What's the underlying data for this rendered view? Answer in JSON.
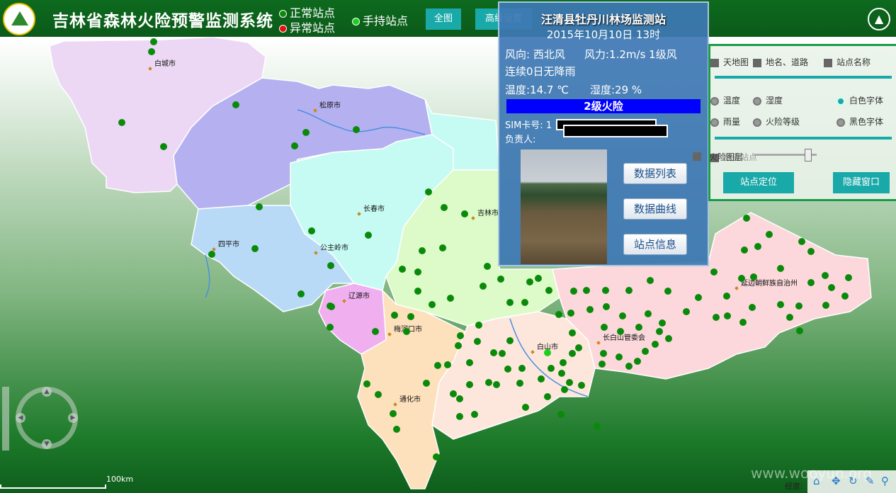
{
  "header": {
    "title": "吉林省森林火险预警监测系统",
    "legend_normal": "正常站点",
    "legend_abnormal": "异常站点",
    "legend_handheld": "手持站点",
    "btn_full": "全图",
    "btn_advanced": "高级设置"
  },
  "popup": {
    "station": "汪清县牡丹川林场监测站",
    "datetime": "2015年10月10日  13时",
    "wind_dir": "风向: 西北风",
    "wind_force": "风力:1.2m/s  1级风",
    "rain": "连续0日无降雨",
    "temp": "温度:14.7 ℃",
    "humidity": "湿度:29 %",
    "fire_level": "2级火险",
    "sim_label": "SIM卡号: 1",
    "owner_label": "负责人:",
    "btn_data_list": "数据列表",
    "btn_data_curve": "数据曲线",
    "btn_station_info": "站点信息"
  },
  "panel": {
    "layer_opts": [
      "天地图",
      "地名、道路",
      "站点名称"
    ],
    "row2": [
      "温度",
      "湿度",
      "白色字体"
    ],
    "row3": [
      "雨量",
      "火险等级",
      "黑色字体"
    ],
    "row4": [
      "测量站点",
      "火险图层"
    ],
    "slider_value": 0.85,
    "btn_locate": "站点定位",
    "btn_hide": "隐藏窗口"
  },
  "map": {
    "cities": [
      "白城市",
      "松原市",
      "长春市",
      "吉林市",
      "四平市",
      "公主岭市",
      "辽源市",
      "梅河口市",
      "通化市",
      "白山市",
      "长白山管委会",
      "延边朝鲜族自治州"
    ],
    "scale_label": "100km",
    "coord_label": "经度:",
    "watermark": "www.wooyun.org",
    "colors": {
      "normal": "#0a8a0a",
      "abnormal": "#e01010",
      "handheld": "#1ad01a",
      "accent": "#19a9a8",
      "fire": "#0000ff"
    }
  }
}
